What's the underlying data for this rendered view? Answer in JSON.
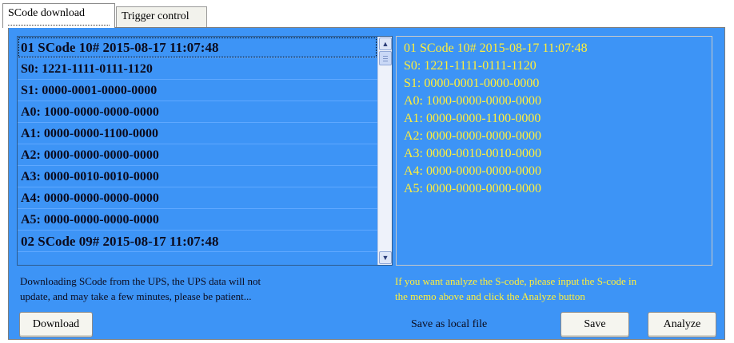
{
  "tabs": [
    {
      "label": "SCode download"
    },
    {
      "label": "Trigger control"
    }
  ],
  "scode_list": {
    "items": [
      "01 SCode 10# 2015-08-17 11:07:48",
      "S0: 1221-1111-0111-1120",
      "S1: 0000-0001-0000-0000",
      "A0: 1000-0000-0000-0000",
      "A1: 0000-0000-1100-0000",
      "A2: 0000-0000-0000-0000",
      "A3: 0000-0010-0010-0000",
      "A4: 0000-0000-0000-0000",
      "A5: 0000-0000-0000-0000",
      "02 SCode 09# 2015-08-17 11:07:48"
    ],
    "scroll_up_icon": "arrow-up-icon",
    "scroll_down_icon": "arrow-down-icon"
  },
  "memo": {
    "lines": [
      "01 SCode 10# 2015-08-17 11:07:48",
      "S0: 1221-1111-0111-1120",
      "S1: 0000-0001-0000-0000",
      "A0: 1000-0000-0000-0000",
      "A1: 0000-0000-1100-0000",
      "A2: 0000-0000-0000-0000",
      "A3: 0000-0010-0010-0000",
      "A4: 0000-0000-0000-0000",
      "A5: 0000-0000-0000-0000"
    ]
  },
  "info": {
    "download_line1": "Downloading SCode from the UPS, the UPS data will not",
    "download_line2": "update, and may take a few minutes, please be patient...",
    "analyze_line1": "If you want analyze the S-code, please input the S-code in",
    "analyze_line2": "the memo above and click the Analyze button"
  },
  "buttons": {
    "download": "Download",
    "save_as_label": "Save as local file",
    "save": "Save",
    "analyze": "Analyze"
  },
  "colors": {
    "panel_bg": "#3d94f6",
    "memo_text": "#ffef3a",
    "list_text": "#0b0b1e"
  }
}
